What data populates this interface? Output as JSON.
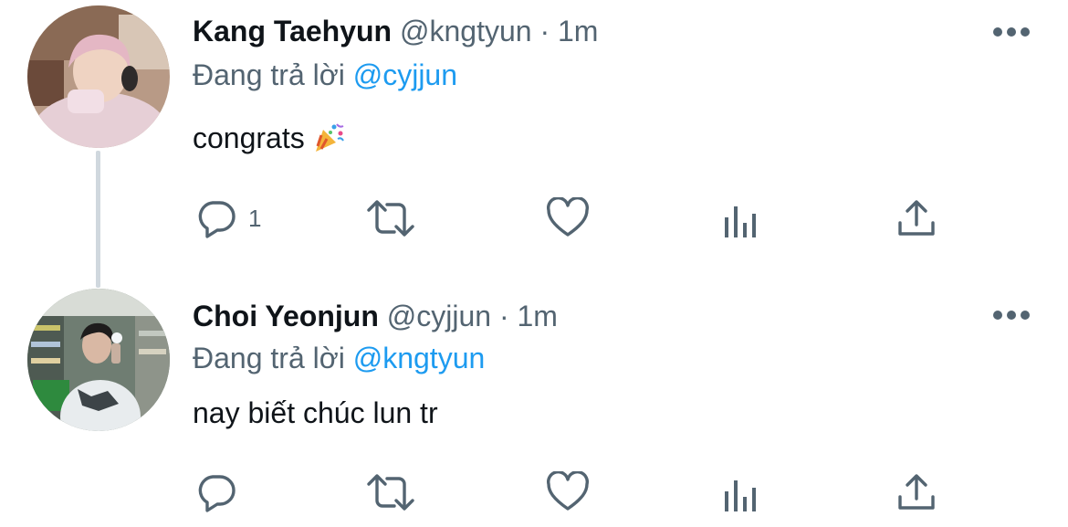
{
  "tweets": [
    {
      "display_name": "Kang Taehyun",
      "handle": "@kngtyun",
      "separator": "·",
      "time": "1m",
      "replying_prefix": "Đang trả lời",
      "replying_to": "@cyjjun",
      "text": "congrats",
      "emoji": "party-popper-icon",
      "reply_count": "1"
    },
    {
      "display_name": "Choi Yeonjun",
      "handle": "@cyjjun",
      "separator": "·",
      "time": "1m",
      "replying_prefix": "Đang trả lời",
      "replying_to": "@kngtyun",
      "text": "nay biết chúc lun tr",
      "reply_count": ""
    }
  ],
  "icons": {
    "reply": "reply-icon",
    "retweet": "retweet-icon",
    "like": "heart-icon",
    "views": "views-icon",
    "share": "share-icon",
    "more": "more-icon"
  },
  "colors": {
    "text": "#0f1419",
    "secondary": "#536471",
    "mention": "#1d9bf0",
    "thread_line": "#d0d8de"
  }
}
